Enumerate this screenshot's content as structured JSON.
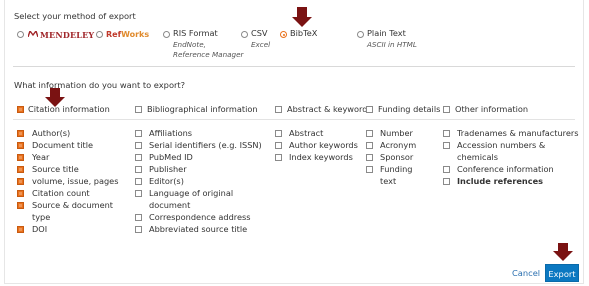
{
  "method": {
    "heading": "Select your method of export",
    "options": [
      {
        "label": "MENDELEY",
        "sub": []
      },
      {
        "label": "RefWorks",
        "sub": []
      },
      {
        "label": "RIS Format",
        "sub": [
          "EndNote,",
          "Reference Manager"
        ]
      },
      {
        "label": "CSV",
        "sub": [
          "Excel"
        ]
      },
      {
        "label": "BibTeX",
        "sub": []
      },
      {
        "label": "Plain Text",
        "sub": [
          "ASCII in HTML"
        ]
      }
    ],
    "selected": "BibTeX"
  },
  "info": {
    "heading": "What information do you want to export?",
    "groups": [
      {
        "label": "Citation information",
        "checked": true
      },
      {
        "label": "Bibliographical information",
        "checked": false
      },
      {
        "label": "Abstract & keywords",
        "checked": false
      },
      {
        "label": "Funding details",
        "checked": false
      },
      {
        "label": "Other information",
        "checked": false
      }
    ],
    "citation_items": [
      "Author(s)",
      "Document title",
      "Year",
      "Source title",
      "volume, issue, pages",
      "Citation count",
      "Source & document",
      "type",
      "DOI"
    ],
    "bibliographical_items": [
      "Affiliations",
      "Serial identifiers (e.g. ISSN)",
      "PubMed ID",
      "Publisher",
      "Editor(s)",
      "Language of original",
      "document",
      "Correspondence address",
      "Abbreviated source title"
    ],
    "abstract_items": [
      "Abstract",
      "Author keywords",
      "Index keywords"
    ],
    "funding_items": [
      "Number",
      "Acronym",
      "Sponsor",
      "Funding",
      "text"
    ],
    "other_items": [
      "Tradenames & manufacturers",
      "Accession numbers &",
      "chemicals",
      "Conference information",
      "Include references"
    ]
  },
  "actions": {
    "cancel": "Cancel",
    "export": "Export"
  },
  "colors": {
    "accent": "#e9711c",
    "export_button": "#0b78c1",
    "arrow": "#7a1212",
    "mendeley": "#a0262a"
  }
}
